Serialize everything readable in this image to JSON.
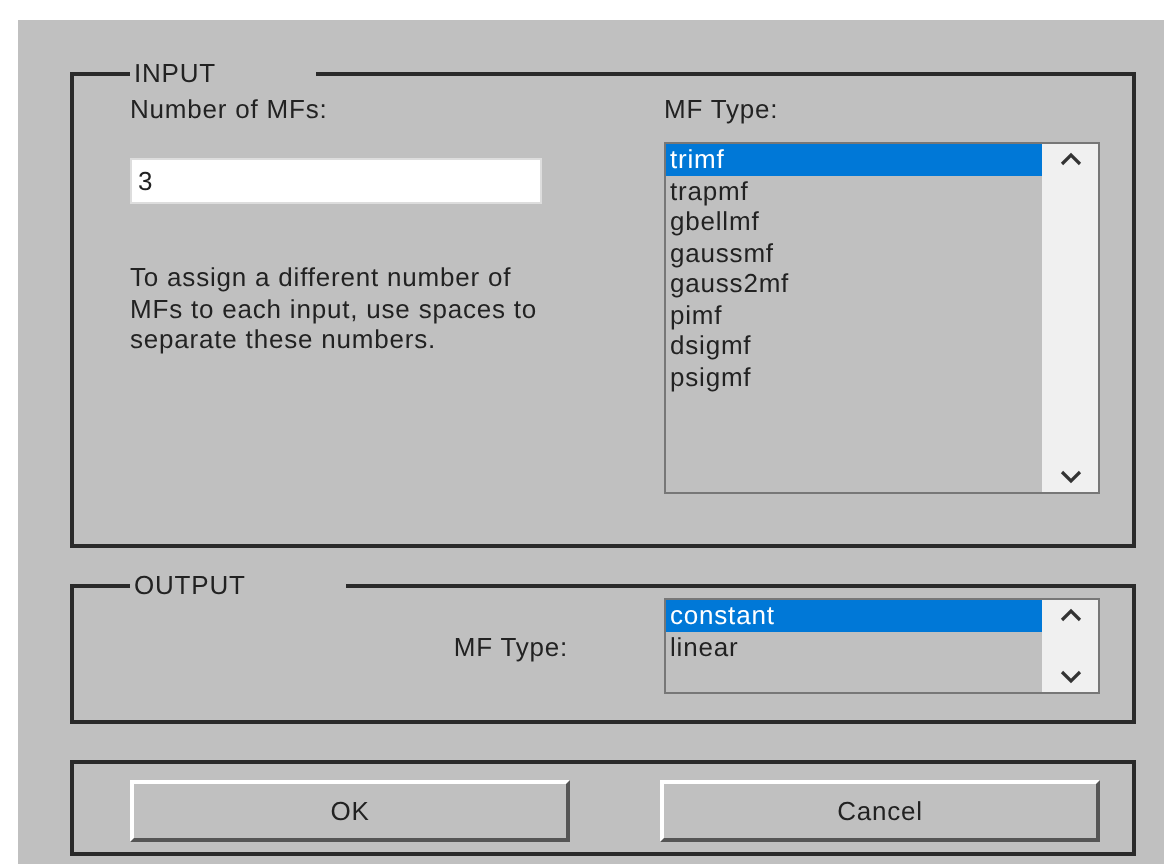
{
  "input": {
    "legend": "INPUT",
    "count_label": "Number of MFs:",
    "count_value": "3",
    "help": "To assign a different number of MFs to each input, use spaces to separate these numbers.",
    "type_label": "MF Type:",
    "types": [
      {
        "label": "trimf",
        "selected": true
      },
      {
        "label": "trapmf",
        "selected": false
      },
      {
        "label": "gbellmf",
        "selected": false
      },
      {
        "label": "gaussmf",
        "selected": false
      },
      {
        "label": "gauss2mf",
        "selected": false
      },
      {
        "label": "pimf",
        "selected": false
      },
      {
        "label": "dsigmf",
        "selected": false
      },
      {
        "label": "psigmf",
        "selected": false
      }
    ]
  },
  "output": {
    "legend": "OUTPUT",
    "type_label": "MF Type:",
    "types": [
      {
        "label": "constant",
        "selected": true
      },
      {
        "label": "linear",
        "selected": false
      }
    ]
  },
  "buttons": [
    {
      "label": "OK"
    },
    {
      "label": "Cancel"
    }
  ]
}
